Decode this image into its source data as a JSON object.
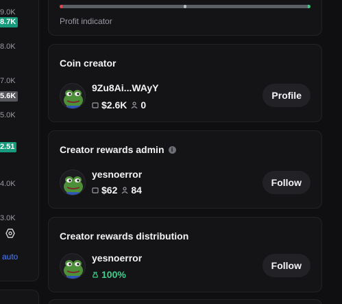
{
  "chart_axis": {
    "labels": [
      "9.0K",
      "8.0K",
      "7.0K",
      "5.0K",
      "4.0K",
      "3.0K"
    ],
    "badges": [
      {
        "text": "8.7K",
        "color": "#169b7c"
      },
      {
        "text": "5.6K",
        "color": "#55555c"
      },
      {
        "text": "2.51",
        "color": "#169b7c"
      }
    ],
    "auto_label": "auto"
  },
  "profit": {
    "caption": "Profit indicator",
    "marker_fraction": 0.5
  },
  "coin_creator": {
    "title": "Coin creator",
    "name": "9Zu8Ai...WAyY",
    "value": "$2.6K",
    "followers": "0",
    "button": "Profile",
    "avatar_icon": "pepe-frog-avatar"
  },
  "rewards_admin": {
    "title": "Creator rewards admin",
    "info_icon": "i",
    "name": "yesnoerror",
    "value": "$62",
    "followers": "84",
    "button": "Follow",
    "avatar_icon": "pepe-frog-avatar"
  },
  "rewards_distribution": {
    "title": "Creator rewards distribution",
    "name": "yesnoerror",
    "share": "100%",
    "button": "Follow",
    "avatar_icon": "pepe-frog-avatar"
  },
  "colors": {
    "accent_green": "#3ed08a",
    "badge_green": "#169b7c",
    "loss_red": "#e0494f",
    "link_blue": "#4a7dff"
  }
}
